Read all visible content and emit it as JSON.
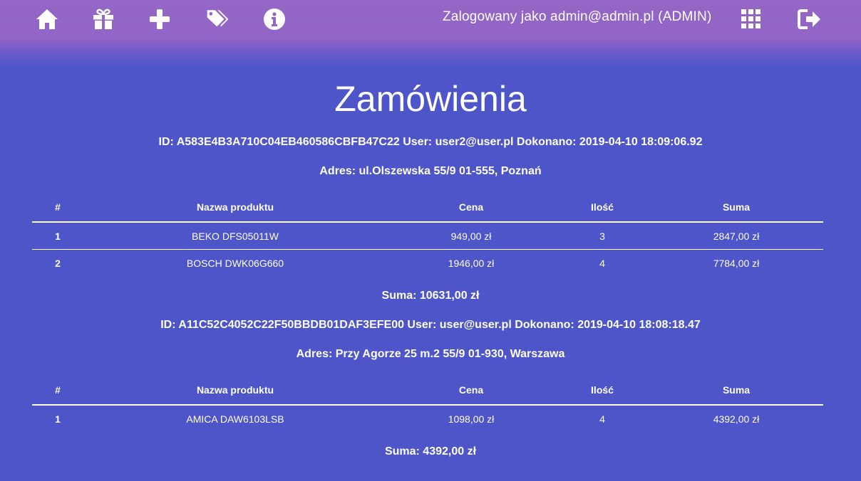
{
  "navbar": {
    "icons": [
      "home-icon",
      "gift-icon",
      "plus-icon",
      "tags-icon",
      "info-icon"
    ],
    "user_label": "Zalogowany jako admin@admin.pl (ADMIN)",
    "right_icons": [
      "grid-icon",
      "logout-icon"
    ]
  },
  "page": {
    "title": "Zamówienia"
  },
  "orders": [
    {
      "header": "ID: A583E4B3A710C04EB460586CBFB47C22 User: user2@user.pl Dokonano: 2019-04-10 18:09:06.92",
      "address": "Adres: ul.Olszewska 55/9 01-555, Poznań",
      "columns": [
        "#",
        "Nazwa produktu",
        "Cena",
        "Ilość",
        "Suma"
      ],
      "rows": [
        {
          "num": "1",
          "name": "BEKO DFS05011W",
          "price": "949,00 zł",
          "qty": "3",
          "sum": "2847,00 zł"
        },
        {
          "num": "2",
          "name": "BOSCH DWK06G660",
          "price": "1946,00 zł",
          "qty": "4",
          "sum": "7784,00 zł"
        }
      ],
      "total": "Suma: 10631,00 zł"
    },
    {
      "header": "ID: A11C52C4052C22F50BBDB01DAF3EFE00 User: user@user.pl Dokonano: 2019-04-10 18:08:18.47",
      "address": "Adres: Przy Agorze 25 m.2 55/9 01-930, Warszawa",
      "columns": [
        "#",
        "Nazwa produktu",
        "Cena",
        "Ilość",
        "Suma"
      ],
      "rows": [
        {
          "num": "1",
          "name": "AMICA DAW6103LSB",
          "price": "1098,00 zł",
          "qty": "4",
          "sum": "4392,00 zł"
        }
      ],
      "total": "Suma: 4392,00 zł"
    }
  ]
}
